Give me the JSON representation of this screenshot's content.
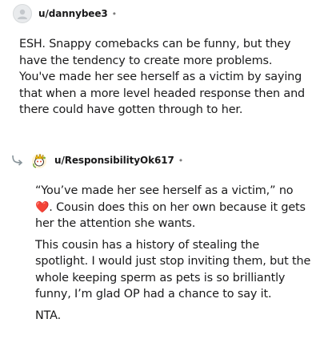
{
  "comments": [
    {
      "username": "u/dannybee3",
      "separator": "•",
      "avatar_icon": "default-user-avatar-icon",
      "paragraphs": [
        "ESH. Snappy comebacks can be funny, but they have the tendency to create more problems. You've made her see herself as a victim by saying that when a more level headed response then and there could have gotten through to her."
      ]
    },
    {
      "username": "u/ResponsibilityOk617",
      "separator": "•",
      "avatar_icon": "snoo-avatar-icon",
      "reply_icon": "reply-arrow-icon",
      "paragraphs": [
        "“You’ve made her see herself as a victim,” no",
        "This cousin has a history of stealing the spotlight. I would just stop inviting them, but the whole keeping sperm as pets is so brilliantly funny, I’m glad OP had a chance to say it.",
        "NTA."
      ],
      "first_paragraph_tail": ". Cousin does this on her own because it gets her the attention she wants.",
      "heart_emoji": "❤️"
    }
  ]
}
